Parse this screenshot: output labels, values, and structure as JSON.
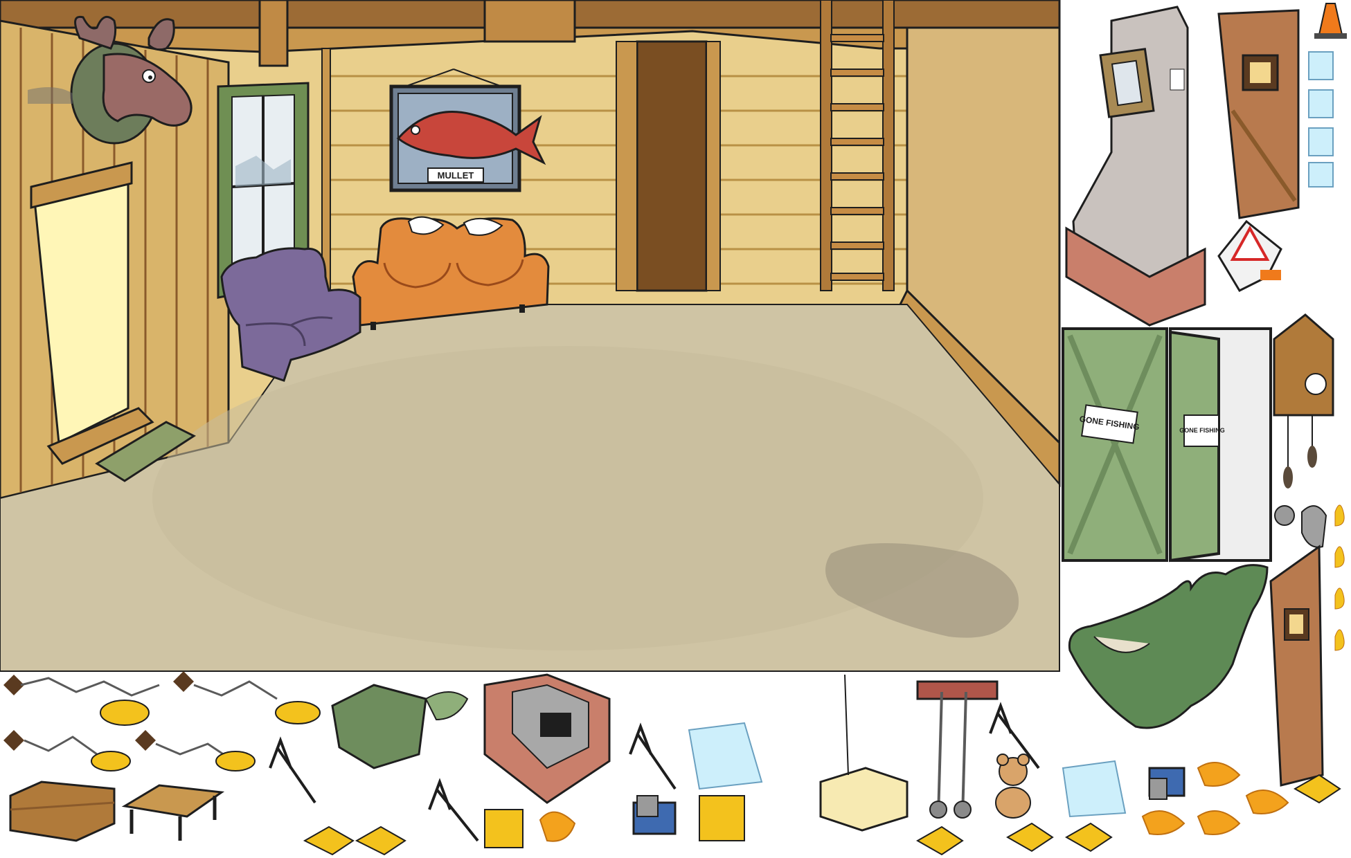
{
  "scene": {
    "name": "cabin-interior-sprite-sheet",
    "palette": {
      "wall_light": "#EFD58E",
      "wall_mid": "#D9B46A",
      "wood_dark": "#8A5A2B",
      "beam": "#C9984F",
      "floor": "#CFC4A4",
      "floor_shadow": "#B5A98A",
      "outline": "#1E1E1E",
      "sofa_orange": "#E38B3D",
      "armchair_purple": "#7C6A9A",
      "green_door": "#8FAF7A",
      "green_chair": "#5E8A55",
      "fish_red": "#C8463B",
      "moose": "#9A6A66",
      "yellow_fish": "#F3C21D",
      "cone_orange": "#F07A1B"
    }
  },
  "room": {
    "fish_plaque_label": "MULLET"
  },
  "sprites": {
    "gone_fishing_closed": "GONE FISHING",
    "gone_fishing_open": "GONE FISHING"
  }
}
